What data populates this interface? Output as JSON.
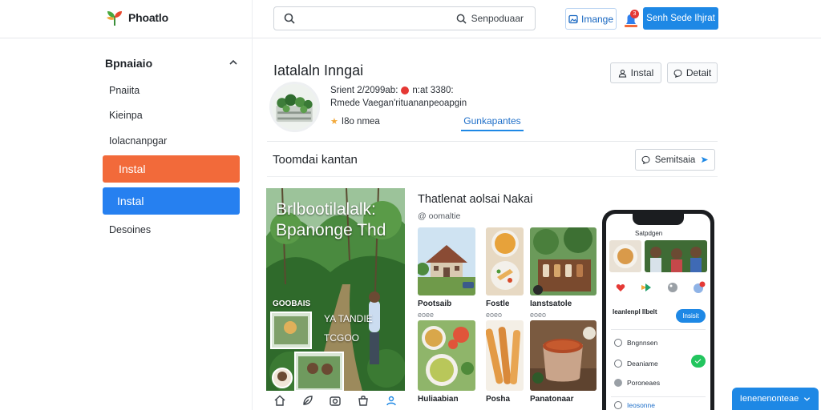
{
  "header": {
    "logo_text": "Phoatlo",
    "search_right_label": "Senpoduaar",
    "manage_label": "Imange",
    "notification_count": "3",
    "primary_label": "Senh Sede Ihjrat"
  },
  "sidebar": {
    "title": "Bpnaiaio",
    "items": [
      "Pnaiita",
      "Kieinpa",
      "Iolacnanpgar"
    ],
    "button_orange": "Instal",
    "button_blue": "Instal",
    "bottom_item": "Desoines"
  },
  "profile": {
    "title": "Iatalaln Inngai",
    "install_label": "Instal",
    "detail_label": "Detait",
    "meta_line1_a": "Srient 2/2099ab:",
    "meta_line1_b": "n:at 3380:",
    "meta_line2": "Rmede Vaegan'rituananpeoapgin",
    "meta_line3": "I8o  nmea",
    "active_tab": "Gunkapantes"
  },
  "section": {
    "title": "Toomdai kantan",
    "button_label": "Semitsaia"
  },
  "poster": {
    "title": "Brlbootilalalk: Bpanonge Thd",
    "small1": "GOOBAIS",
    "small2": "YA TANDIE",
    "small3": "TCGOO"
  },
  "grid": {
    "title": "Thatlenat aolsai Nakai",
    "subtitle": "oomaltie",
    "tiles": [
      {
        "label": "Pootsaib",
        "meta": "eoee"
      },
      {
        "label": "Fostle",
        "meta": "eoeo"
      },
      {
        "label": "Ianstsatole",
        "meta": "eoeo"
      },
      {
        "label": "Huliaabian",
        "meta": ""
      },
      {
        "label": "Posha",
        "meta": ""
      },
      {
        "label": "Panatonaar",
        "meta": ""
      }
    ]
  },
  "phone": {
    "header": "Satpdgen",
    "row_title": "Ieanlenpl Ilbelt",
    "row_button": "Insisit",
    "items": [
      "Bngnnsen",
      "Deaniame",
      "Poroneaes",
      "Ieosonne"
    ],
    "badge": "9"
  },
  "floating_button": "Ienenenonteae",
  "colors": {
    "accent_blue": "#1e88e5",
    "accent_orange": "#f26a3a",
    "sidebar_blue_button": "#2680f0",
    "toggle_green": "#22c55e"
  }
}
